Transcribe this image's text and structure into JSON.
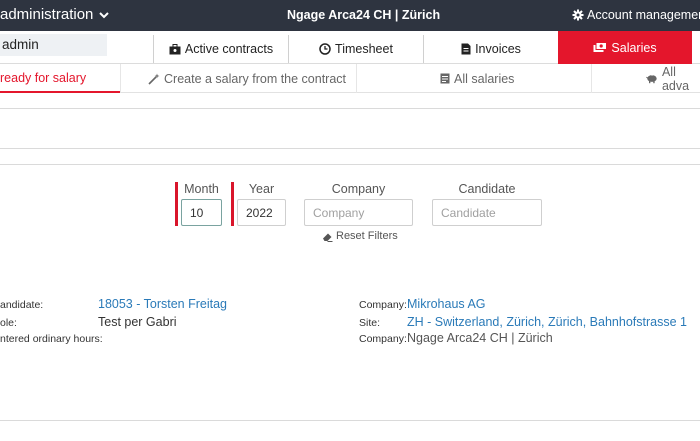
{
  "topbar": {
    "brand": "administration",
    "center_title": "Ngage Arca24 CH | Zürich",
    "account": "Account management"
  },
  "user": {
    "name": "admin"
  },
  "main_tabs": [
    {
      "label": "Active contracts",
      "icon": "briefcase-icon"
    },
    {
      "label": "Timesheet",
      "icon": "clock-icon"
    },
    {
      "label": "Invoices",
      "icon": "invoice-icon"
    },
    {
      "label": "Salaries",
      "icon": "money-icon",
      "active": true
    }
  ],
  "sub_tabs": [
    {
      "label": "ready for salary",
      "active": true
    },
    {
      "label": "Create a salary from the contract",
      "icon": "magic-wand-icon"
    },
    {
      "label": "All salaries",
      "icon": "list-icon"
    },
    {
      "label": "All adva",
      "icon": "piggy-bank-icon"
    }
  ],
  "filters": {
    "month": {
      "label": "Month",
      "value": "10"
    },
    "year": {
      "label": "Year",
      "value": "2022"
    },
    "company": {
      "label": "Company",
      "placeholder": "Company"
    },
    "candidate": {
      "label": "Candidate",
      "placeholder": "Candidate"
    },
    "reset_label": "Reset Filters"
  },
  "details": {
    "candidate_label": "andidate:",
    "candidate_value": "18053 - Torsten Freitag",
    "role_label": "ole:",
    "role_value": "Test per Gabri",
    "hours_label": "ntered ordinary hours:",
    "company_label": "Company:",
    "company_value": "Mikrohaus AG",
    "site_label": "Site:",
    "site_value": "ZH - Switzerland, Zürich, Zürich, Bahnhofstrasse 1",
    "company2_label": "Company:",
    "company2_value": "Ngage Arca24 CH | Zürich"
  },
  "colors": {
    "accent": "#e4162c",
    "topbar": "#2e3440",
    "link": "#2a7ab8"
  }
}
